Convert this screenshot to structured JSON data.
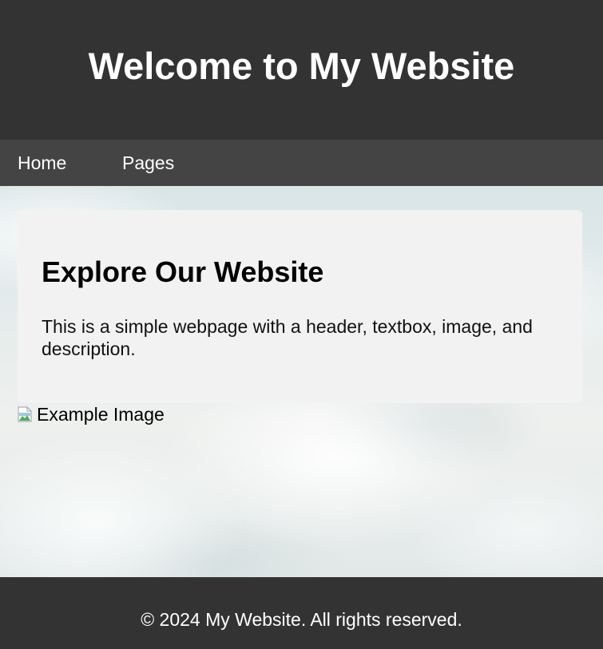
{
  "header": {
    "title": "Welcome to My Website"
  },
  "nav": {
    "items": [
      {
        "label": "Home"
      },
      {
        "label": "Pages"
      }
    ]
  },
  "main": {
    "card": {
      "heading": "Explore Our Website",
      "description": "This is a simple webpage with a header, textbox, image, and description."
    },
    "image": {
      "alt": "Example Image",
      "icon": "broken-image-icon"
    }
  },
  "footer": {
    "text": "© 2024 My Website. All rights reserved."
  },
  "colors": {
    "header_bg": "#333333",
    "nav_bg": "#444444",
    "card_bg": "#f2f2f2",
    "footer_bg": "#333333",
    "text_light": "#ffffff"
  }
}
